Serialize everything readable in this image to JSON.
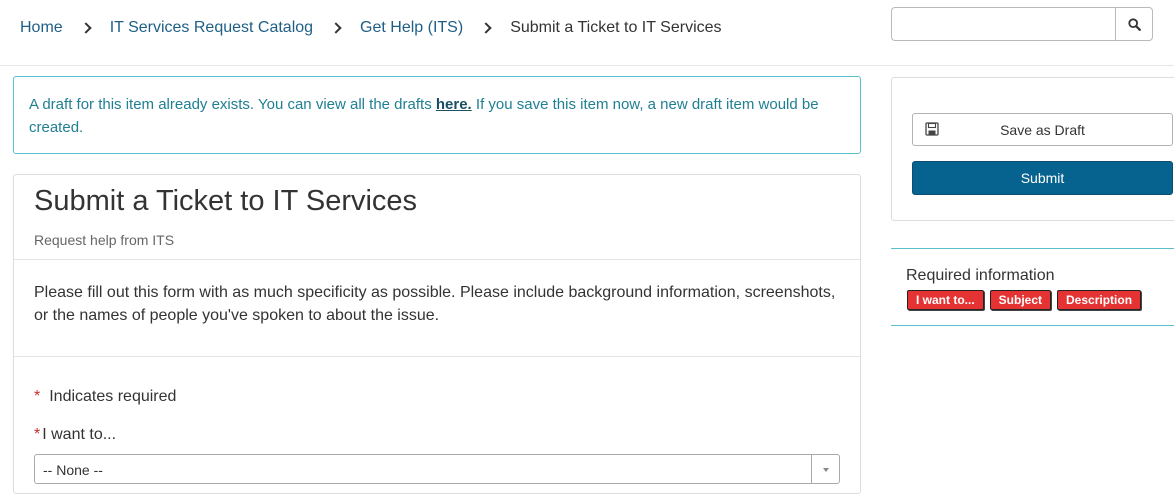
{
  "breadcrumb": {
    "items": [
      "Home",
      "IT Services Request Catalog",
      "Get Help (ITS)"
    ],
    "current": "Submit a Ticket to IT Services"
  },
  "search": {
    "value": "",
    "icon": "search-icon"
  },
  "alert": {
    "text_before": "A draft for this item already exists. You can view all the drafts ",
    "link_text": "here.",
    "text_after": " If you save this item now, a new draft item would be created."
  },
  "form": {
    "title": "Submit a Ticket to IT Services",
    "subtitle": "Request help from ITS",
    "description": "Please fill out this form with as much specificity as possible. Please include background information, screenshots, or the names of people you've spoken to about the issue.",
    "required_note": "Indicates required",
    "required_marker": "*",
    "field_label": "I want to...",
    "field_value": "-- None --"
  },
  "actions": {
    "save_draft": "Save as Draft",
    "submit": "Submit"
  },
  "required_info": {
    "title": "Required information",
    "tags": [
      "I want to...",
      "Subject",
      "Description"
    ]
  },
  "colors": {
    "link": "#1f5f86",
    "alert_border": "#5bc0ce",
    "submit_bg": "#06638f",
    "tag_bg": "#e53333",
    "required_star": "#c9302c"
  }
}
